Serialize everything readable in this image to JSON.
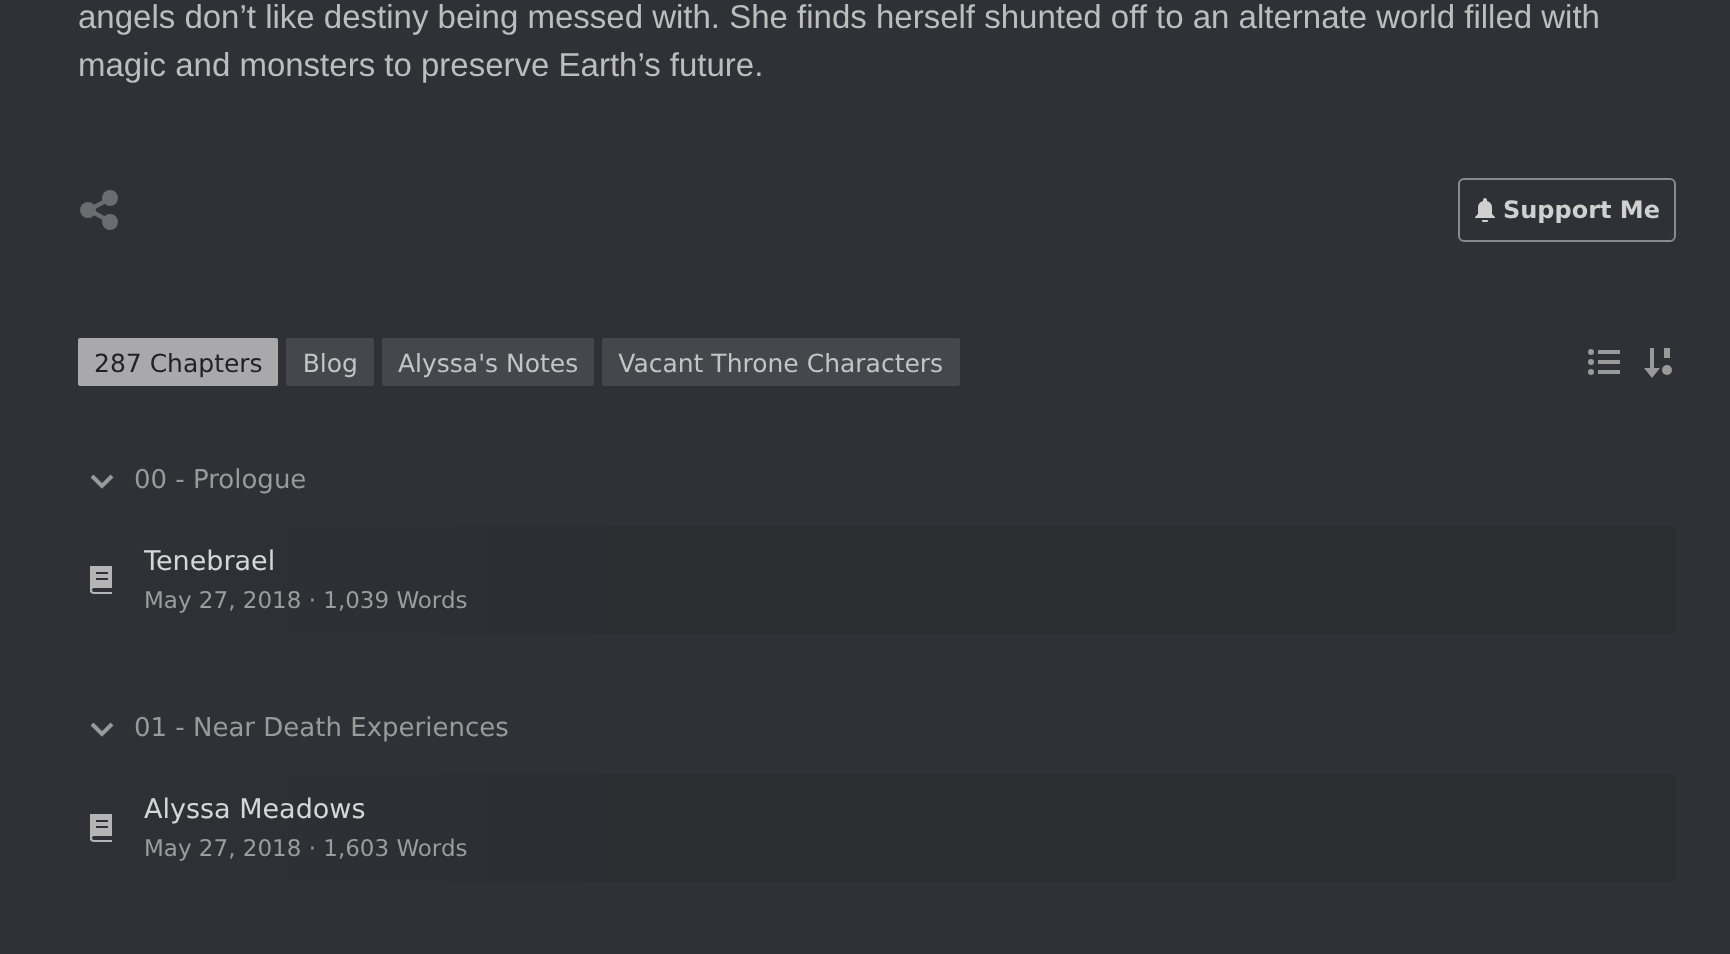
{
  "description": "angels don’t like destiny being messed with. She finds herself shunted off to an alternate world filled with magic and monsters to preserve Earth’s future.",
  "support_button": "Support Me",
  "tabs": [
    {
      "label": "287 Chapters",
      "selected": true
    },
    {
      "label": "Blog",
      "selected": false
    },
    {
      "label": "Alyssa's Notes",
      "selected": false
    },
    {
      "label": "Vacant Throne Characters",
      "selected": false
    }
  ],
  "groups": [
    {
      "title": "00 - Prologue",
      "expanded": true,
      "chapters": [
        {
          "title": "Tenebrael",
          "date": "May 27, 2018",
          "words": "1,039 Words"
        }
      ]
    },
    {
      "title": "01 - Near Death Experiences",
      "expanded": true,
      "chapters": [
        {
          "title": "Alyssa Meadows",
          "date": "May 27, 2018",
          "words": "1,603 Words"
        }
      ]
    }
  ],
  "meta_separator": "·"
}
